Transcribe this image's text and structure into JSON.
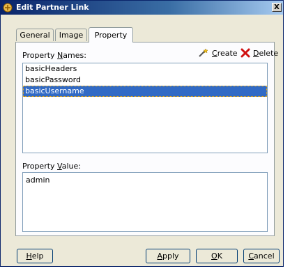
{
  "window": {
    "title": "Edit Partner Link",
    "close_glyph": "X"
  },
  "tabs": [
    {
      "label": "General"
    },
    {
      "label": "Image"
    },
    {
      "label": "Property",
      "active": true
    }
  ],
  "property_names": {
    "label_prefix": "Property ",
    "label_mnemonic": "N",
    "label_suffix": "ames:",
    "create_mnemonic": "C",
    "create_rest": "reate",
    "delete_mnemonic": "D",
    "delete_rest": "elete",
    "items": [
      "basicHeaders",
      "basicPassword",
      "basicUsername"
    ],
    "selected_index": 2
  },
  "property_value": {
    "label_prefix": "Property ",
    "label_mnemonic": "V",
    "label_suffix": "alue:",
    "value": "admin"
  },
  "buttons": {
    "help_mnemonic": "H",
    "help_rest": "elp",
    "apply_mnemonic": "A",
    "apply_rest": "pply",
    "ok_mnemonic": "O",
    "ok_rest": "K",
    "cancel_mnemonic": "C",
    "cancel_rest": "ancel"
  }
}
